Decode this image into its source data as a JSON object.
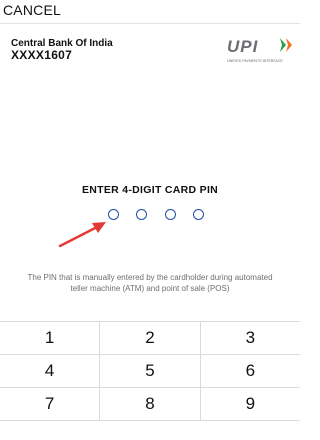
{
  "header": {
    "cancel_label": "CANCEL"
  },
  "account": {
    "bank_name": "Central Bank Of India",
    "masked_number": "XXXX1607"
  },
  "logo": {
    "text": "UPI",
    "tagline": "UNIFIED PAYMENTS INTERFACE",
    "colors": {
      "dark": "#6d6e71",
      "green": "#2e9b45",
      "orange": "#f26f21"
    }
  },
  "pin": {
    "title": "ENTER 4-DIGIT CARD PIN",
    "digit_count": 4,
    "dot_color": "#1f4ea8",
    "arrow_color": "#e53935"
  },
  "helper_text": "The PIN that is manually entered by the cardholder during automated teller machine (ATM) and point of sale (POS)",
  "keypad": {
    "rows": [
      [
        "1",
        "2",
        "3"
      ],
      [
        "4",
        "5",
        "6"
      ],
      [
        "7",
        "8",
        "9"
      ]
    ]
  }
}
